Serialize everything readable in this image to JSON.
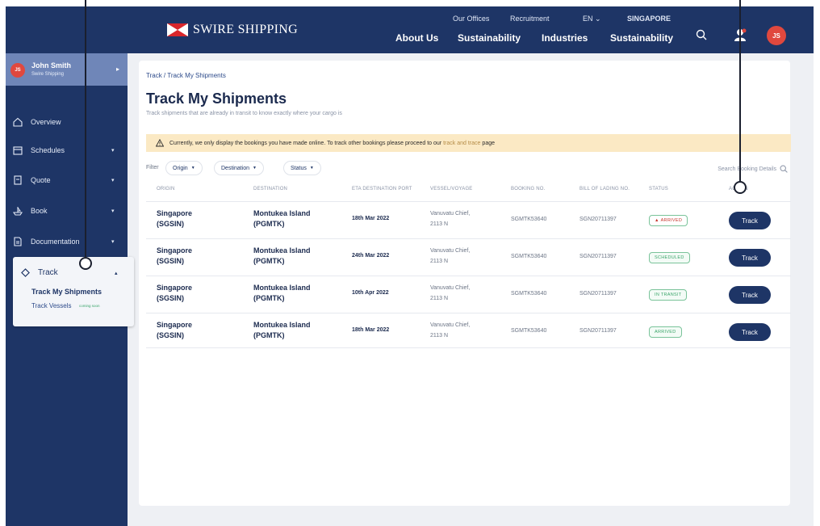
{
  "header": {
    "brand": "SWIRE SHIPPING",
    "utility_links": [
      "Our Offices",
      "Recruitment",
      "EN ⌄",
      "SINGAPORE"
    ],
    "nav": [
      "About Us",
      "Sustainability",
      "Industries",
      "Sustainability"
    ],
    "avatar_initials": "JS"
  },
  "user": {
    "initials": "JS",
    "name": "John Smith",
    "company": "Swire Shipping"
  },
  "sidebar": {
    "items": [
      {
        "label": "Overview",
        "icon": "home-icon"
      },
      {
        "label": "Schedules",
        "icon": "calendar-icon"
      },
      {
        "label": "Quote",
        "icon": "document-icon"
      },
      {
        "label": "Book",
        "icon": "ship-icon"
      },
      {
        "label": "Documentation",
        "icon": "file-icon"
      }
    ],
    "track": {
      "label": "Track",
      "sub_items": [
        "Track My Shipments",
        "Track Vessels"
      ],
      "coming_soon": "coming soon"
    }
  },
  "main": {
    "breadcrumb": "Track / Track My Shipments",
    "title": "Track My Shipments",
    "subtitle": "Track shipments that are already in transit to know exactly where your cargo is",
    "banner": {
      "text": "Currently, we only display the bookings you have made online. To track other bookings please proceed to our",
      "link": "track and trace",
      "suffix": "page"
    },
    "filter_label": "Filter",
    "filters": [
      "Origin",
      "Destination",
      "Status"
    ],
    "search_placeholder": "Search Booking Details"
  },
  "table": {
    "columns": [
      "ORIGIN",
      "DESTINATION",
      "ETA DESTINATION PORT",
      "VESSEL/VOYAGE",
      "BOOKING NO.",
      "BILL OF LADING NO.",
      "STATUS",
      "ACTION"
    ],
    "rows": [
      {
        "origin": "Singapore",
        "origin_code": "(SGSIN)",
        "destination": "Montukea Island",
        "destination_code": "(PGMTK)",
        "eta": "18th Mar 2022",
        "vessel": "Vanuvatu Chief,",
        "voyage": "2113 N",
        "booking": "SGMTK53640",
        "bol": "SGN20711397",
        "status": "ARRIVED",
        "action": "Track"
      },
      {
        "origin": "Singapore",
        "origin_code": "(SGSIN)",
        "destination": "Montukea Island",
        "destination_code": "(PGMTK)",
        "eta": "24th Mar 2022",
        "vessel": "Vanuvatu Chief,",
        "voyage": "2113 N",
        "booking": "SGMTK53640",
        "bol": "SGN20711397",
        "status": "SCHEDULED",
        "action": "Track"
      },
      {
        "origin": "Singapore",
        "origin_code": "(SGSIN)",
        "destination": "Montukea Island",
        "destination_code": "(PGMTK)",
        "eta": "10th Apr 2022",
        "vessel": "Vanuvatu Chief,",
        "voyage": "2113 N",
        "booking": "SGMTK53640",
        "bol": "SGN20711397",
        "status": "IN TRANSIT",
        "action": "Track"
      },
      {
        "origin": "Singapore",
        "origin_code": "(SGSIN)",
        "destination": "Montukea Island",
        "destination_code": "(PGMTK)",
        "eta": "18th Mar 2022",
        "vessel": "Vanuvatu Chief,",
        "voyage": "2113 N",
        "booking": "SGMTK53640",
        "bol": "SGN20711397",
        "status": "ARRIVED",
        "action": "Track"
      }
    ]
  },
  "colors": {
    "navy": "#1e3566",
    "accent_red": "#e0483e",
    "status_green": "#3aa56a",
    "banner_yellow": "#fbe9c4"
  }
}
